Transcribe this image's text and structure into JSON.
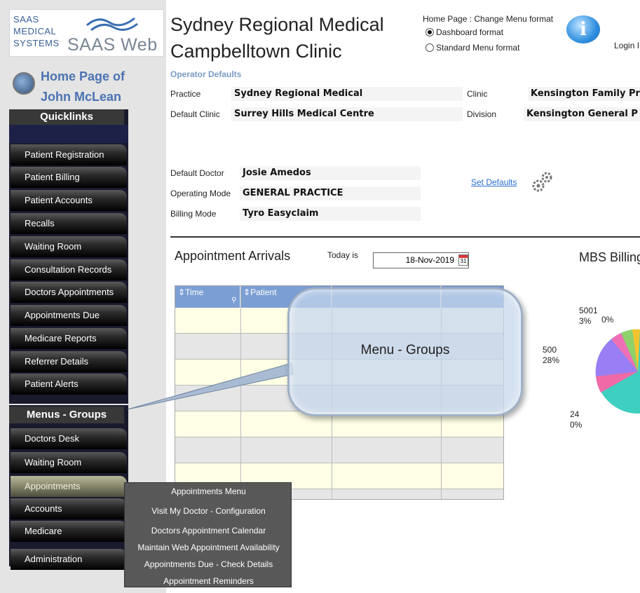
{
  "brand": {
    "logo_line1": "SAAS",
    "logo_line2": "MEDICAL",
    "logo_line3": "SYSTEMS",
    "logo_word": "SAAS Web"
  },
  "home": {
    "line1": "Home Page of",
    "line2": "John McLean"
  },
  "quicklinks": {
    "header": "Quicklinks",
    "items": [
      "Patient Registration",
      "Patient Billing",
      "Patient Accounts",
      "Recalls",
      "Waiting Room",
      "Consultation Records",
      "Doctors Appointments",
      "Appointments Due",
      "Medicare Reports",
      "Referrer Details",
      "Patient Alerts"
    ]
  },
  "menu_groups": {
    "header": "Menus - Groups",
    "items": [
      "Doctors Desk",
      "Waiting Room",
      "Appointments",
      "Accounts",
      "Medicare",
      "Administration"
    ],
    "active": "Appointments"
  },
  "dropdown": {
    "items": [
      "Appointments Menu",
      "Visit My Doctor - Configuration",
      "Doctors Appointment Calendar",
      "Maintain Web Appointment Availability",
      "Appointments Due - Check Details",
      "Appointment Reminders"
    ]
  },
  "header": {
    "title_line1": "Sydney Regional Medical",
    "title_line2": "Campbelltown Clinic",
    "menu_format_title": "Home Page : Change Menu format",
    "option_dashboard": "Dashboard format",
    "option_standard": "Standard Menu format",
    "selected_option": "Dashboard format",
    "login": "Login I"
  },
  "operator_defaults": {
    "heading": "Operator Defaults",
    "practice_label": "Practice",
    "practice_value": "Sydney Regional Medical",
    "clinic_label": "Clinic",
    "clinic_value": "Kensington Family Pr",
    "default_clinic_label": "Default Clinic",
    "default_clinic_value": "Surrey Hills Medical Centre",
    "division_label": "Division",
    "division_value": "Kensington General P",
    "default_doctor_label": "Default Doctor",
    "default_doctor_value": "Josie Amedos",
    "operating_mode_label": "Operating Mode",
    "operating_mode_value": "GENERAL PRACTICE",
    "billing_mode_label": "Billing Mode",
    "billing_mode_value": "Tyro Easyclaim",
    "set_defaults": "Set Defaults"
  },
  "arrivals": {
    "title": "Appointment Arrivals",
    "today_label": "Today is",
    "date": "18-Nov-2019",
    "columns": [
      "Time",
      "Patient"
    ]
  },
  "callout": {
    "text": "Menu - Groups"
  },
  "mbs": {
    "title": "MBS Billing",
    "labels": [
      {
        "code": "5001",
        "pct": "3%"
      },
      {
        "code": "",
        "pct": "0%"
      },
      {
        "code": "500",
        "pct": "28%"
      },
      {
        "code": "24",
        "pct": "0%"
      }
    ]
  },
  "colors": {
    "accent_blue": "#4b73b1",
    "grid_header": "#7c9fd3",
    "row_yellow": "#ffffe6",
    "row_grey": "#e6e6e6",
    "dropdown_bg": "#585858",
    "nav_dark": "#000000"
  }
}
